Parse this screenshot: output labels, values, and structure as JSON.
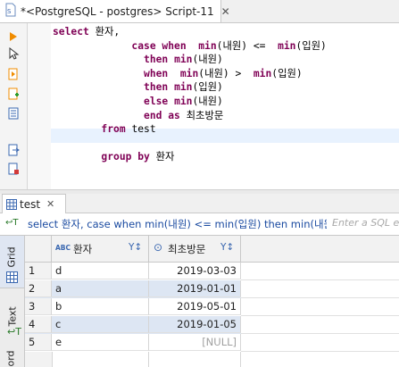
{
  "editor_tab": {
    "title": "*<PostgreSQL - postgres> Script-11",
    "close": "✕"
  },
  "code_lines": [
    [
      [
        "kw",
        "select"
      ],
      [
        "t",
        " 환자,"
      ]
    ],
    [
      [
        "t",
        "             "
      ],
      [
        "kw",
        "case when"
      ],
      [
        "t",
        "  "
      ],
      [
        "kw",
        "min"
      ],
      [
        "t",
        "(내원) <=  "
      ],
      [
        "kw",
        "min"
      ],
      [
        "t",
        "(입원)"
      ]
    ],
    [
      [
        "t",
        "               "
      ],
      [
        "kw",
        "then"
      ],
      [
        "t",
        " "
      ],
      [
        "kw",
        "min"
      ],
      [
        "t",
        "(내원)"
      ]
    ],
    [
      [
        "t",
        "               "
      ],
      [
        "kw",
        "when"
      ],
      [
        "t",
        "  "
      ],
      [
        "kw",
        "min"
      ],
      [
        "t",
        "(내원) >  "
      ],
      [
        "kw",
        "min"
      ],
      [
        "t",
        "(입원)"
      ]
    ],
    [
      [
        "t",
        "               "
      ],
      [
        "kw",
        "then"
      ],
      [
        "t",
        " "
      ],
      [
        "kw",
        "min"
      ],
      [
        "t",
        "(입원)"
      ]
    ],
    [
      [
        "t",
        "               "
      ],
      [
        "kw",
        "else"
      ],
      [
        "t",
        " "
      ],
      [
        "kw",
        "min"
      ],
      [
        "t",
        "(내원)"
      ]
    ],
    [
      [
        "t",
        "               "
      ],
      [
        "kw",
        "end"
      ],
      [
        "t",
        " "
      ],
      [
        "kw",
        "as"
      ],
      [
        "t",
        " 최초방문"
      ]
    ],
    [
      [
        "t",
        "        "
      ],
      [
        "kw",
        "from"
      ],
      [
        "t",
        " test"
      ]
    ],
    [
      [
        "t",
        ""
      ]
    ],
    [
      [
        "t",
        "        "
      ],
      [
        "kw",
        "group by"
      ],
      [
        "t",
        " 환자"
      ]
    ]
  ],
  "results_tab": {
    "label": "test",
    "close": "✕"
  },
  "filter": {
    "icon": "↩T",
    "query": "select 환자, case when min(내원) <= min(입원) then min(내원) when min(내원) > min(입원) then min(입원) else min(내원) end as 최초방문",
    "placeholder": "Enter a SQL e"
  },
  "side_tabs": {
    "grid": "Grid",
    "text": "Text",
    "record": "Record"
  },
  "grid": {
    "columns": [
      {
        "type_badge": "ABC",
        "name": "환자",
        "filter_icon": "Y↕"
      },
      {
        "type_badge": "⊙",
        "name": "최초방문",
        "filter_icon": "Y↕"
      }
    ],
    "rows": [
      {
        "num": "1",
        "patient": "d",
        "first_visit": "2019-03-03"
      },
      {
        "num": "2",
        "patient": "a",
        "first_visit": "2019-01-01"
      },
      {
        "num": "3",
        "patient": "b",
        "first_visit": "2019-05-01"
      },
      {
        "num": "4",
        "patient": "c",
        "first_visit": "2019-01-05"
      },
      {
        "num": "5",
        "patient": "e",
        "first_visit": "[NULL]"
      }
    ]
  },
  "colors": {
    "keyword": "#7f0055",
    "row_alt": "#dde6f3",
    "filter_text": "#1a4aa0"
  }
}
